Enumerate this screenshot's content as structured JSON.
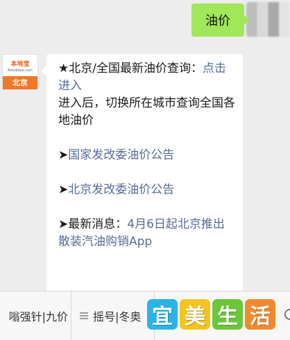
{
  "outgoing_message": {
    "text": "油价"
  },
  "sender_avatar": {
    "brand": "本地宝",
    "domain": "Bendibao.com",
    "city": "北京"
  },
  "incoming_message": {
    "line1_prefix": "★北京/全国最新油价查询",
    "line1_colon": "：",
    "line1_link": "点击进入",
    "line2": "进入后，切换所在城市查询全国各地油价",
    "bullet": "➤",
    "link_ndrc": "国家发改委油价公告",
    "link_beijing": "北京发改委油价公告",
    "news_prefix": "最新消息：",
    "news_link": "4月6日起北京推出散装汽油购销App"
  },
  "menu": {
    "items": [
      "嗡强针|九价",
      "摇号|冬奥",
      ""
    ]
  },
  "watermark": {
    "chars": [
      "宜",
      "美",
      "生",
      "活"
    ]
  },
  "colors": {
    "link": "#576b95",
    "outgoing_bubble": "#a0e75a",
    "avatar_orange": "#f0782a"
  }
}
